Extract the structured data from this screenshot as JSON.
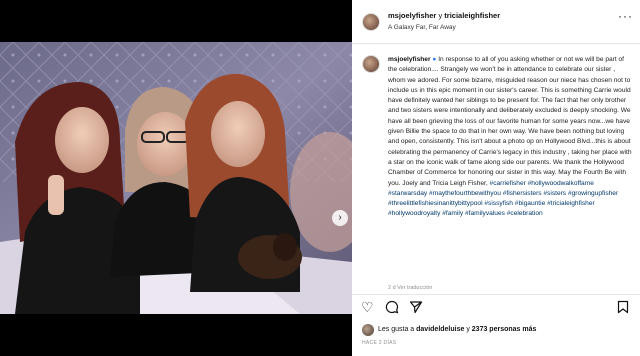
{
  "header": {
    "author": "msjoelyfisher",
    "connector": " y ",
    "coauthor": "tricialeighfisher",
    "location": "A Galaxy Far, Far Away",
    "more_icon": "more-horizontal-icon"
  },
  "caption": {
    "user": "msjoelyfisher",
    "emoji_icon": "blue-circle-icon",
    "body": "In response to all of you asking whether or not we will be part of the celebration.... Strangely we won't be in attendance to celebrate our sister , whom we adored. For some bizarre, misguided reason our niece has chosen not to include us in this epic moment in our sister's career. This is something Carrie would have definitely wanted her siblings to be present for. The fact that her only brother and two sisters were intentionally and deliberately excluded is deeply shocking. We have all been grieving the loss of our favorite human for some years now...we have given Billie the space to do that in her own way. We have been nothing but loving and open, consistently. This isn't about a photo op on Hollywood Blvd...this is about celebrating the permanency of Carrie's legacy in this industry , taking her place with a star on the iconic walk of fame along side our parents. We thank the Hollywood Chamber of Commerce for honoring our sister in this way. May the Fourth Be with you. Joely and Tricia Leigh Fisher, ",
    "hashtags": "#carriefisher #hollywoodwalkoffame #starwarsday #maythefourthbewithyou #fishersisters #sisters #growingupfisher #threelittlefishiesinanittybittypool #sissyfish #bigauntie #tricialeighfisher #hollywoodroyalty #family #familyvalues #celebration",
    "meta": "2 d   Ver traducción"
  },
  "actions": {
    "like_icon": "heart-icon",
    "comment_icon": "comment-icon",
    "share_icon": "share-icon",
    "save_icon": "bookmark-icon"
  },
  "likes": {
    "prefix": "Les gusta a ",
    "user": "davideldeluise",
    "middle": " y ",
    "count": "2373 personas más"
  },
  "post_date": "HACE 2 DÍAS",
  "photo": {
    "user_tag_icon": "user-tag-icon",
    "next_icon": "chevron-right-icon"
  }
}
